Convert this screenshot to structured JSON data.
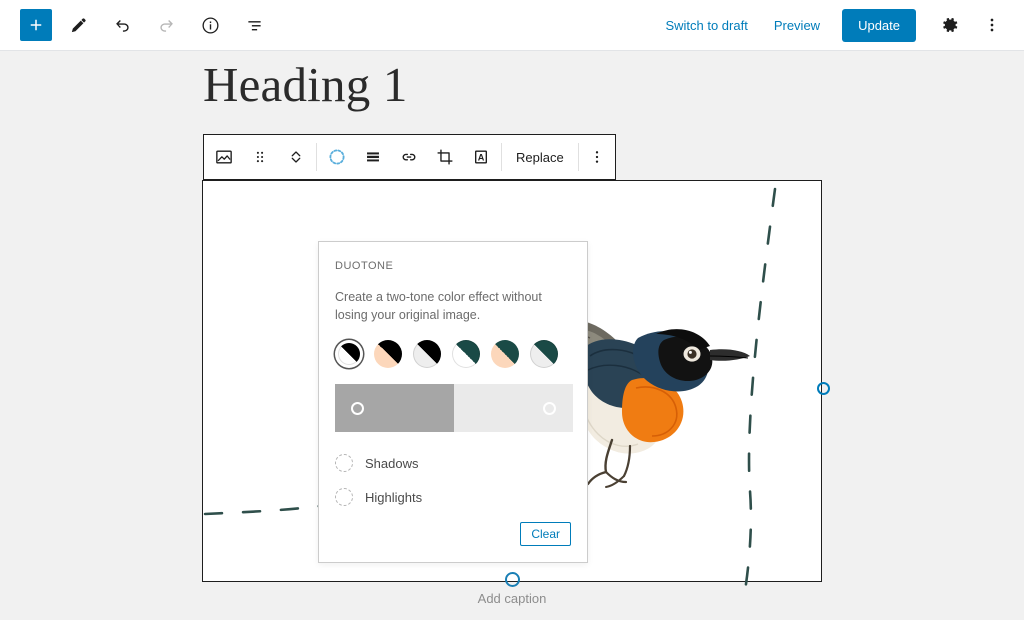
{
  "header": {
    "left_tools": [
      {
        "name": "add-block-button",
        "icon": "plus-icon",
        "label": "Add block"
      },
      {
        "name": "edit-mode-button",
        "icon": "pencil-icon",
        "label": "Edit"
      },
      {
        "name": "undo-button",
        "icon": "undo-icon",
        "label": "Undo"
      },
      {
        "name": "redo-button",
        "icon": "redo-icon",
        "label": "Redo",
        "disabled": true
      },
      {
        "name": "details-button",
        "icon": "info-icon",
        "label": "Details"
      },
      {
        "name": "list-view-button",
        "icon": "list-view-icon",
        "label": "List view"
      }
    ],
    "switch_to_draft_label": "Switch to draft",
    "preview_label": "Preview",
    "update_label": "Update",
    "settings_icon": "gear-icon",
    "more_icon": "ellipsis-vertical-icon",
    "accent_color": "#007cba"
  },
  "document": {
    "title": "Heading 1",
    "caption_placeholder": "Add caption",
    "caption_icon": "circle-handle-icon"
  },
  "block_toolbar": {
    "buttons": [
      {
        "name": "block-type-image-button",
        "icon": "image-icon",
        "label": "Image"
      },
      {
        "name": "drag-handle-button",
        "icon": "drag-dots-icon",
        "label": "Drag"
      },
      {
        "name": "move-updown-button",
        "icon": "chevron-updown-icon",
        "label": "Move up or down"
      },
      {
        "name": "duotone-filter-button",
        "icon": "duotone-circle-icon",
        "label": "Apply duotone filter",
        "active": true
      },
      {
        "name": "align-button",
        "icon": "align-icon",
        "label": "Align"
      },
      {
        "name": "link-button",
        "icon": "link-icon",
        "label": "Insert link"
      },
      {
        "name": "crop-button",
        "icon": "crop-icon",
        "label": "Crop"
      },
      {
        "name": "text-over-image-button",
        "icon": "text-over-image-icon",
        "label": "Add text over image"
      }
    ],
    "replace_label": "Replace",
    "more_options_icon": "ellipsis-vertical-icon"
  },
  "duotone_popover": {
    "section_label": "DUOTONE",
    "description": "Create a two-tone color effect without losing your original image.",
    "swatches": [
      {
        "name": "duotone-swatch-grayscale",
        "shadow": "#000000",
        "highlight": "#ffffff",
        "selected": true,
        "label": "Grayscale"
      },
      {
        "name": "duotone-swatch-dark-grayscale",
        "shadow": "#000000",
        "highlight": "#fcd7bb",
        "selected": false,
        "label": "Black and peach"
      },
      {
        "name": "duotone-swatch-black-white",
        "shadow": "#000000",
        "highlight": "#eeeeee",
        "selected": false,
        "label": "Black and white"
      },
      {
        "name": "duotone-swatch-teal-white",
        "shadow": "#1a4a46",
        "highlight": "#ffffff",
        "selected": false,
        "label": "Dark green and white"
      },
      {
        "name": "duotone-swatch-teal-peach",
        "shadow": "#1a4a46",
        "highlight": "#fcd7bb",
        "selected": false,
        "label": "Dark green and peach"
      },
      {
        "name": "duotone-swatch-teal-grey",
        "shadow": "#1a4a46",
        "highlight": "#eeeeee",
        "selected": false,
        "label": "Dark green and grey"
      }
    ],
    "gradient": {
      "name": "duotone-gradient-bar",
      "shadow_color": "#a6a6a6",
      "highlight_color": "#eaeaea",
      "shadow_stop_percent": 9,
      "highlight_stop_percent": 90
    },
    "color_rows": [
      {
        "name": "duotone-shadows-color",
        "label": "Shadows"
      },
      {
        "name": "duotone-highlights-color",
        "label": "Highlights"
      }
    ],
    "clear_label": "Clear"
  },
  "colors": {
    "page_background": "#f1f1f1",
    "block_background": "#ffffff",
    "block_border": "#1e1e1e",
    "decoration_dash": "#2f4f4b",
    "handle_blue": "#007cba"
  }
}
